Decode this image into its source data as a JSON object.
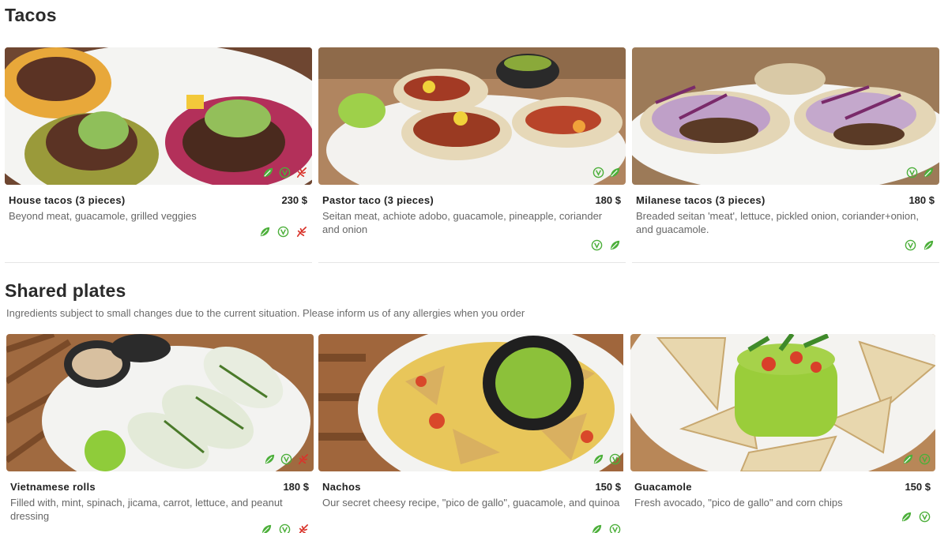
{
  "sections": {
    "tacos": {
      "title": "Tacos",
      "items": [
        {
          "name": "House tacos (3 pieces)",
          "price": "230 $",
          "description": "Beyond meat, guacamole, grilled veggies",
          "icons": [
            "leaf-icon",
            "vegan-icon",
            "spicy-icon"
          ]
        },
        {
          "name": "Pastor taco (3 pieces)",
          "price": "180 $",
          "description": "Seitan meat, achiote adobo, guacamole, pineapple, coriander and onion",
          "icons": [
            "vegan-icon",
            "leaf-icon"
          ]
        },
        {
          "name": "Milanese tacos (3 pieces)",
          "price": "180 $",
          "description": "Breaded seitan 'meat', lettuce, pickled onion, coriander+onion, and guacamole.",
          "icons": [
            "vegan-icon",
            "leaf-icon"
          ]
        }
      ]
    },
    "shared": {
      "title": "Shared plates",
      "note": "Ingredients subject to small changes due to the current situation. Please inform us of any allergies when you order",
      "items": [
        {
          "name": "Vietnamese rolls",
          "price": "180 $",
          "description": "Filled with, mint, spinach, jicama, carrot, lettuce, and peanut dressing",
          "icons": [
            "leaf-icon",
            "vegan-icon",
            "spicy-icon"
          ]
        },
        {
          "name": "Nachos",
          "price": "150 $",
          "description": "Our secret cheesy recipe, \"pico de gallo\", guacamole, and quinoa",
          "icons": [
            "leaf-icon",
            "vegan-icon"
          ]
        },
        {
          "name": "Guacamole",
          "price": "150 $",
          "description": "Fresh avocado, \"pico de gallo\" and corn chips",
          "icons": [
            "leaf-icon",
            "vegan-icon"
          ]
        }
      ]
    }
  },
  "colors": {
    "accent_green": "#4caf3a",
    "spicy_red": "#d9342b",
    "text": "#222222",
    "muted": "#666666"
  }
}
